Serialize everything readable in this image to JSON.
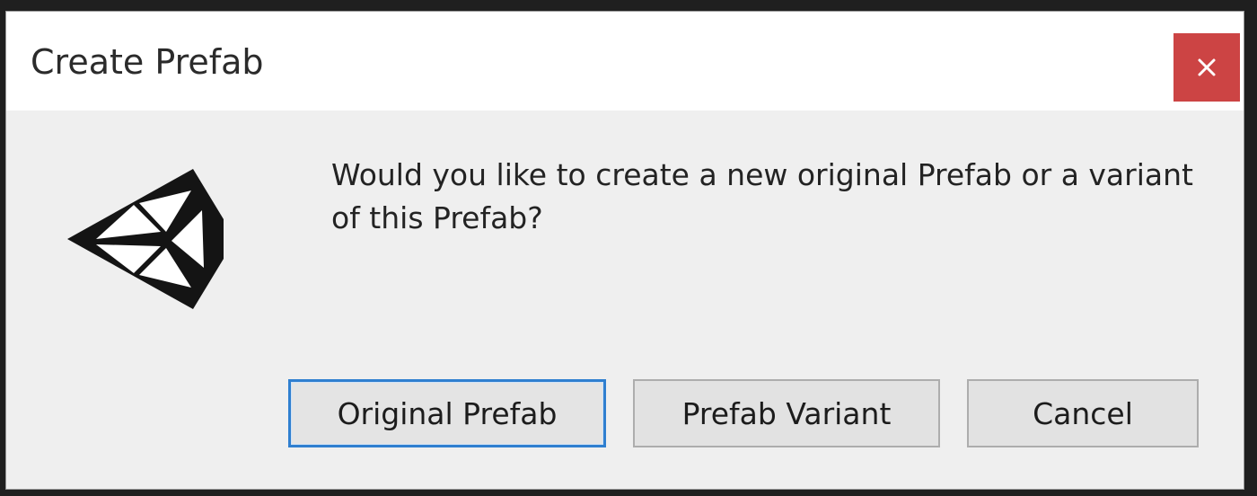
{
  "window": {
    "title": "Create Prefab",
    "close_glyph": "×"
  },
  "message": "Would you like to create a new original Prefab or a variant of this Prefab?",
  "logo": {
    "icon": "unity-logo-icon"
  },
  "buttons": {
    "original": "Original Prefab",
    "variant": "Prefab Variant",
    "cancel": "Cancel"
  },
  "colors": {
    "close_button": "#cc4444",
    "focus_border": "#2f7fd0",
    "dialog_background": "#efefef",
    "titlebar_background": "#ffffff"
  }
}
